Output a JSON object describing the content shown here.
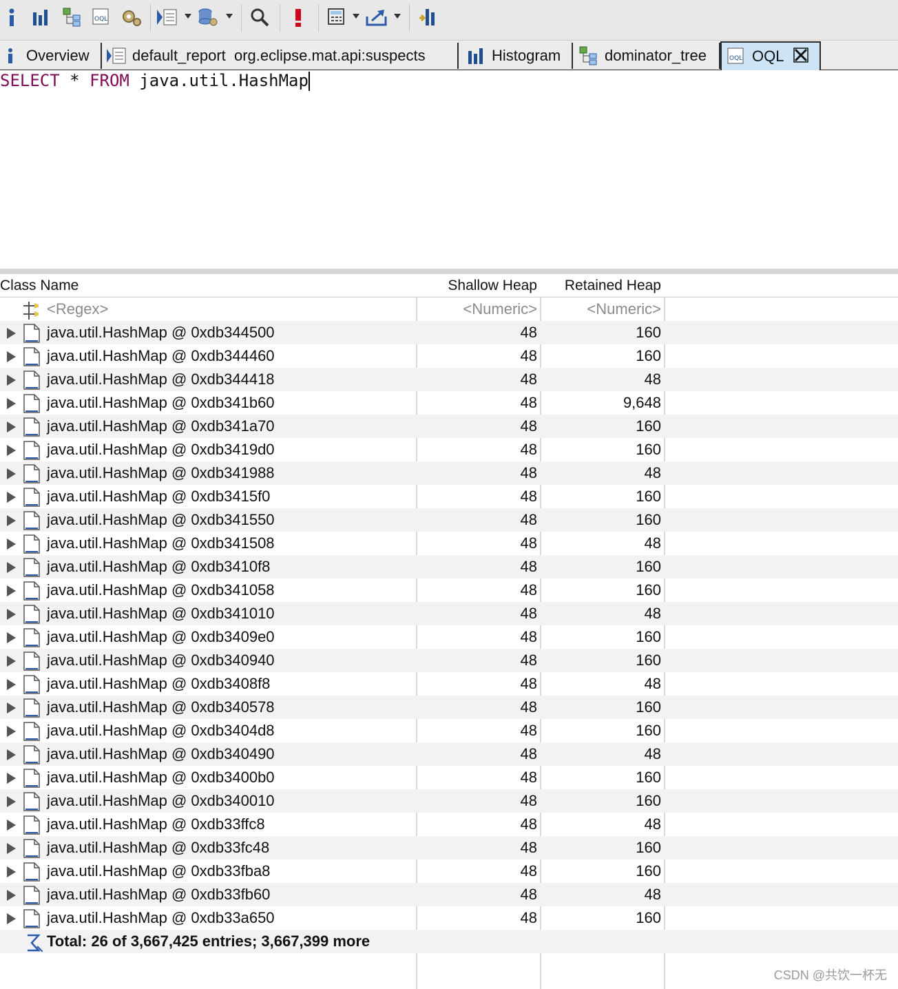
{
  "toolbar": {
    "icons": [
      "info-icon",
      "histogram-icon",
      "dominator-tree-icon",
      "oql-icon",
      "gear-icon",
      "report-icon",
      "query-browser-icon",
      "search-icon",
      "leak-suspect-icon",
      "calculator-icon",
      "export-icon",
      "compare-icon"
    ]
  },
  "tabs": [
    {
      "label": "Overview",
      "icon": "info-icon"
    },
    {
      "label": "default_report  org.eclipse.mat.api:suspects",
      "icon": "report-icon"
    },
    {
      "label": "Histogram",
      "icon": "histogram-icon"
    },
    {
      "label": "dominator_tree",
      "icon": "dominator-tree-icon"
    },
    {
      "label": "OQL",
      "icon": "oql-icon",
      "active": true
    }
  ],
  "query": {
    "kw1": "SELECT",
    "star": " * ",
    "kw2": "FROM",
    "rest": " java.util.HashMap"
  },
  "table": {
    "columns": [
      "Class Name",
      "Shallow Heap",
      "Retained Heap"
    ],
    "filter": {
      "name": "<Regex>",
      "shallow": "<Numeric>",
      "retained": "<Numeric>"
    },
    "rows": [
      {
        "name": "java.util.HashMap @ 0xdb344500",
        "shallow": "48",
        "retained": "160"
      },
      {
        "name": "java.util.HashMap @ 0xdb344460",
        "shallow": "48",
        "retained": "160"
      },
      {
        "name": "java.util.HashMap @ 0xdb344418",
        "shallow": "48",
        "retained": "48"
      },
      {
        "name": "java.util.HashMap @ 0xdb341b60",
        "shallow": "48",
        "retained": "9,648"
      },
      {
        "name": "java.util.HashMap @ 0xdb341a70",
        "shallow": "48",
        "retained": "160"
      },
      {
        "name": "java.util.HashMap @ 0xdb3419d0",
        "shallow": "48",
        "retained": "160"
      },
      {
        "name": "java.util.HashMap @ 0xdb341988",
        "shallow": "48",
        "retained": "48"
      },
      {
        "name": "java.util.HashMap @ 0xdb3415f0",
        "shallow": "48",
        "retained": "160"
      },
      {
        "name": "java.util.HashMap @ 0xdb341550",
        "shallow": "48",
        "retained": "160"
      },
      {
        "name": "java.util.HashMap @ 0xdb341508",
        "shallow": "48",
        "retained": "48"
      },
      {
        "name": "java.util.HashMap @ 0xdb3410f8",
        "shallow": "48",
        "retained": "160"
      },
      {
        "name": "java.util.HashMap @ 0xdb341058",
        "shallow": "48",
        "retained": "160"
      },
      {
        "name": "java.util.HashMap @ 0xdb341010",
        "shallow": "48",
        "retained": "48"
      },
      {
        "name": "java.util.HashMap @ 0xdb3409e0",
        "shallow": "48",
        "retained": "160"
      },
      {
        "name": "java.util.HashMap @ 0xdb340940",
        "shallow": "48",
        "retained": "160"
      },
      {
        "name": "java.util.HashMap @ 0xdb3408f8",
        "shallow": "48",
        "retained": "48"
      },
      {
        "name": "java.util.HashMap @ 0xdb340578",
        "shallow": "48",
        "retained": "160"
      },
      {
        "name": "java.util.HashMap @ 0xdb3404d8",
        "shallow": "48",
        "retained": "160"
      },
      {
        "name": "java.util.HashMap @ 0xdb340490",
        "shallow": "48",
        "retained": "48"
      },
      {
        "name": "java.util.HashMap @ 0xdb3400b0",
        "shallow": "48",
        "retained": "160"
      },
      {
        "name": "java.util.HashMap @ 0xdb340010",
        "shallow": "48",
        "retained": "160"
      },
      {
        "name": "java.util.HashMap @ 0xdb33ffc8",
        "shallow": "48",
        "retained": "48"
      },
      {
        "name": "java.util.HashMap @ 0xdb33fc48",
        "shallow": "48",
        "retained": "160"
      },
      {
        "name": "java.util.HashMap @ 0xdb33fba8",
        "shallow": "48",
        "retained": "160"
      },
      {
        "name": "java.util.HashMap @ 0xdb33fb60",
        "shallow": "48",
        "retained": "48"
      },
      {
        "name": "java.util.HashMap @ 0xdb33a650",
        "shallow": "48",
        "retained": "160"
      }
    ],
    "total": "Total: 26 of 3,667,425 entries; 3,667,399 more"
  },
  "watermark": "CSDN @共饮一杯无",
  "colors": {
    "keyword": "#7f0b55",
    "active_tab": "#cfe3f7",
    "alt_row": "#f2f2f5"
  }
}
